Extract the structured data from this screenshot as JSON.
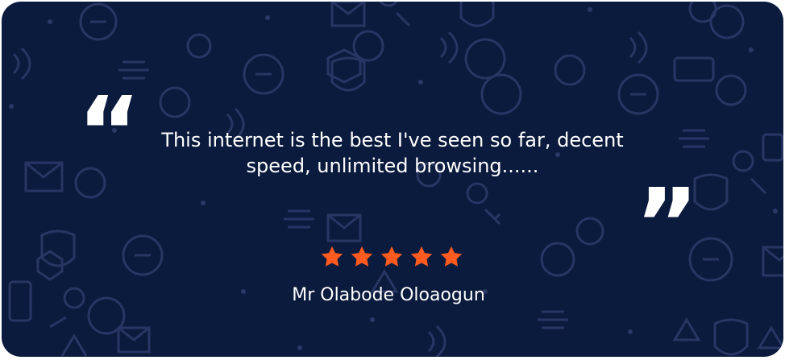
{
  "testimonial": {
    "quote_text": "This internet is  the best I've seen so far, decent speed, unlimited browsing......",
    "open_quote": "“",
    "close_quote": "”",
    "rating": 5,
    "rating_max": 5,
    "author": "Mr Olabode Oloaogun"
  },
  "colors": {
    "background": "#0b1b3d",
    "pattern": "#2a3866",
    "star": "#ff5a1f",
    "text": "#ffffff"
  },
  "icons": [
    "security-pattern-background",
    "star-icon"
  ]
}
